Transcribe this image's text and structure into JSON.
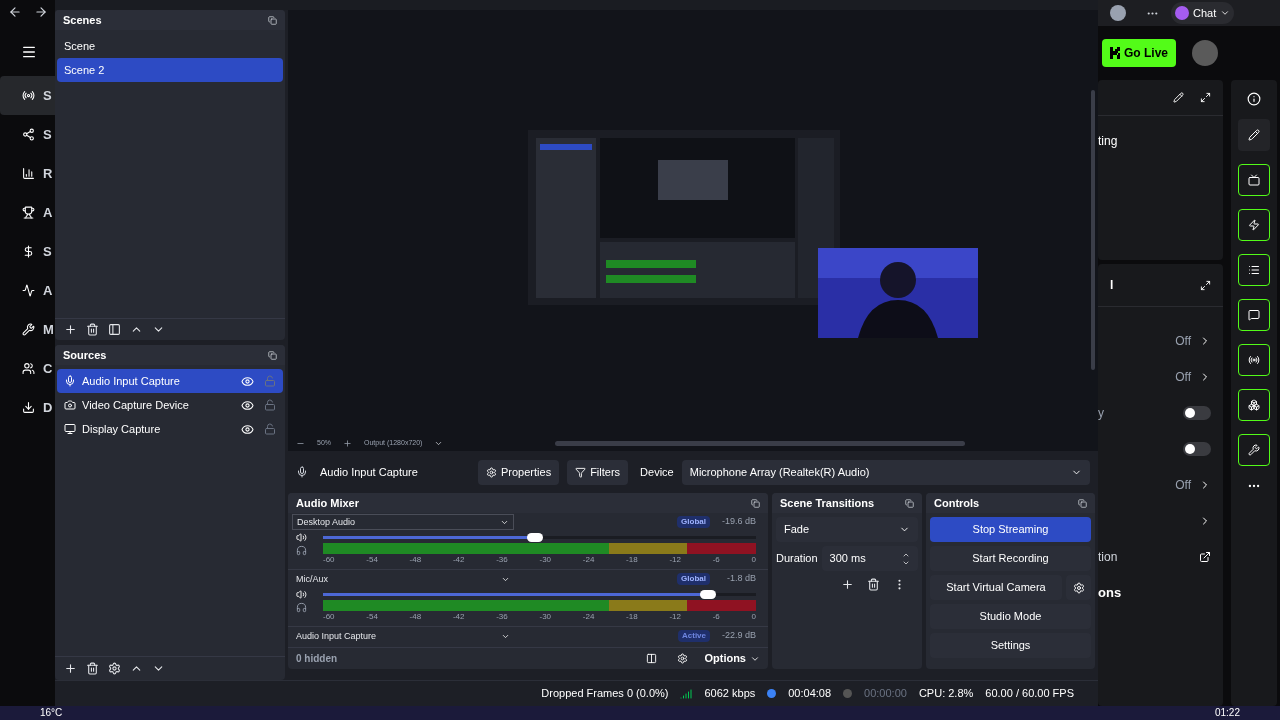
{
  "browser": {
    "rail": [
      {
        "label": "S",
        "selected": true
      },
      {
        "label": "S",
        "selected": false
      },
      {
        "label": "R",
        "selected": false
      },
      {
        "label": "A",
        "selected": false
      },
      {
        "label": "S",
        "selected": false
      },
      {
        "label": "A",
        "selected": false
      },
      {
        "label": "M",
        "selected": false
      },
      {
        "label": "C",
        "selected": false
      },
      {
        "label": "D",
        "selected": false
      }
    ]
  },
  "scenes": {
    "title": "Scenes",
    "items": [
      {
        "name": "Scene",
        "selected": false
      },
      {
        "name": "Scene 2",
        "selected": true
      }
    ]
  },
  "sources": {
    "title": "Sources",
    "items": [
      {
        "kind": "audio",
        "name": "Audio Input Capture",
        "selected": true,
        "visible": true,
        "locked": false
      },
      {
        "kind": "video",
        "name": "Video Capture Device",
        "selected": false,
        "visible": true,
        "locked": false
      },
      {
        "kind": "display",
        "name": "Display Capture",
        "selected": false,
        "visible": true,
        "locked": false
      }
    ]
  },
  "preview_toolbar": {
    "zoom": "50%",
    "output": "Output (1280x720)"
  },
  "source_toolbar": {
    "source": "Audio Input Capture",
    "properties": "Properties",
    "filters": "Filters",
    "device_label": "Device",
    "device": "Microphone Array (Realtek(R) Audio)"
  },
  "mixer": {
    "title": "Audio Mixer",
    "channels": [
      {
        "name": "Desktop Audio",
        "badge": "Global",
        "reading": "-19.6 dB",
        "level": 0.49,
        "scale": [
          "-60",
          "-54",
          "-48",
          "-42",
          "-36",
          "-30",
          "-24",
          "-18",
          "-12",
          "-6",
          "0"
        ]
      },
      {
        "name": "Mic/Aux",
        "badge": "Global",
        "reading": "-1.8 dB",
        "level": 0.89,
        "scale": [
          "-60",
          "-54",
          "-48",
          "-42",
          "-36",
          "-30",
          "-24",
          "-18",
          "-12",
          "-6",
          "0"
        ]
      },
      {
        "name": "Audio Input Capture",
        "badge": "Active",
        "reading": "-22.9 dB"
      }
    ],
    "hidden": "0 hidden",
    "options": "Options"
  },
  "transitions": {
    "title": "Scene Transitions",
    "transition": "Fade",
    "duration_label": "Duration",
    "duration": "300 ms"
  },
  "controls": {
    "title": "Controls",
    "buttons": [
      {
        "label": "Stop Streaming",
        "active": true
      },
      {
        "label": "Start Recording",
        "active": false
      },
      {
        "label": "Start Virtual Camera",
        "active": false
      },
      {
        "label": "Studio Mode",
        "active": false
      },
      {
        "label": "Settings",
        "active": false
      }
    ]
  },
  "status_bar": {
    "dropped": "Dropped Frames 0 (0.0%)",
    "bitrate": "6062 kbps",
    "stream_time": "00:04:08",
    "streaming": true,
    "record_time": "00:00:00",
    "recording": false,
    "cpu": "CPU: 2.8%",
    "fps": "60.00 / 60.00 FPS"
  },
  "right_panel": {
    "chat": "Chat",
    "go_live": "Go Live",
    "card_text": "ting",
    "card2_text": "l",
    "rows": [
      {
        "kind": "value",
        "label": "",
        "value": "Off"
      },
      {
        "kind": "value",
        "value": "Off"
      },
      {
        "kind": "toggle",
        "label": "y",
        "on": false
      },
      {
        "kind": "toggle",
        "on": false
      },
      {
        "kind": "value",
        "value": "Off"
      },
      {
        "kind": "chevron"
      },
      {
        "kind": "link",
        "label": "tion"
      }
    ],
    "footer": "ons"
  },
  "taskbar": {
    "weather": "16°C",
    "time": "01:22"
  }
}
